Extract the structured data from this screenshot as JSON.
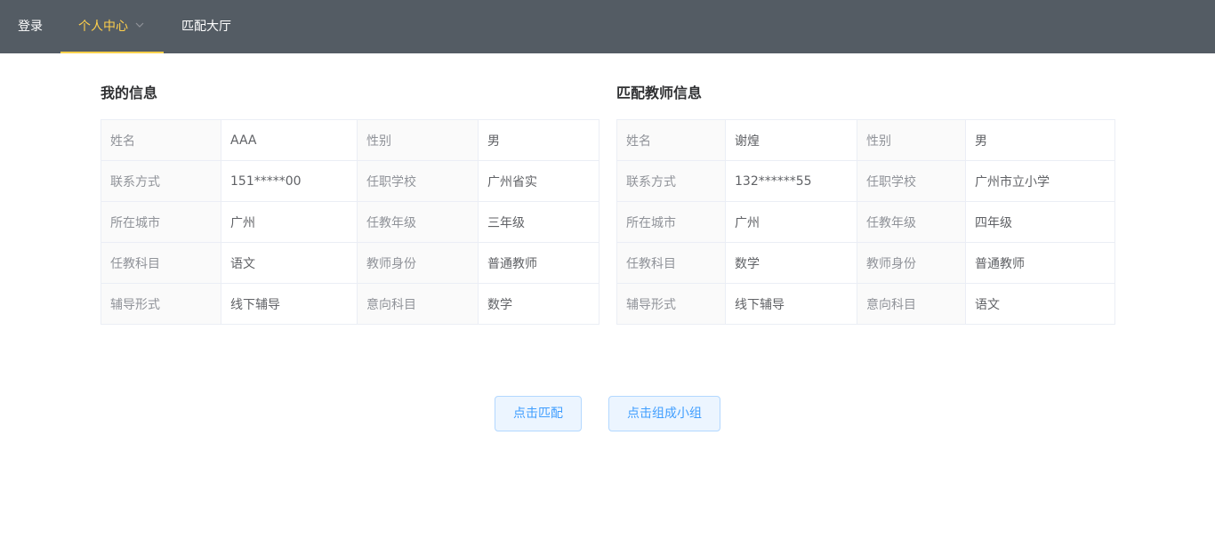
{
  "nav": {
    "login": "登录",
    "personal_center": "个人中心",
    "match_hall": "匹配大厅"
  },
  "my_info": {
    "title": "我的信息",
    "rows": [
      [
        {
          "label": "姓名",
          "value": "AAA"
        },
        {
          "label": "性别",
          "value": "男"
        }
      ],
      [
        {
          "label": "联系方式",
          "value": "151*****00"
        },
        {
          "label": "任职学校",
          "value": "广州省实"
        }
      ],
      [
        {
          "label": "所在城市",
          "value": "广州"
        },
        {
          "label": "任教年级",
          "value": "三年级"
        }
      ],
      [
        {
          "label": "任教科目",
          "value": "语文"
        },
        {
          "label": "教师身份",
          "value": "普通教师"
        }
      ],
      [
        {
          "label": "辅导形式",
          "value": "线下辅导"
        },
        {
          "label": "意向科目",
          "value": "数学"
        }
      ]
    ]
  },
  "teacher_info": {
    "title": "匹配教师信息",
    "rows": [
      [
        {
          "label": "姓名",
          "value": "谢煌"
        },
        {
          "label": "性别",
          "value": "男"
        }
      ],
      [
        {
          "label": "联系方式",
          "value": "132******55"
        },
        {
          "label": "任职学校",
          "value": "广州市立小学"
        }
      ],
      [
        {
          "label": "所在城市",
          "value": "广州"
        },
        {
          "label": "任教年级",
          "value": "四年级"
        }
      ],
      [
        {
          "label": "任教科目",
          "value": "数学"
        },
        {
          "label": "教师身份",
          "value": "普通教师"
        }
      ],
      [
        {
          "label": "辅导形式",
          "value": "线下辅导"
        },
        {
          "label": "意向科目",
          "value": "语文"
        }
      ]
    ]
  },
  "actions": {
    "match": "点击匹配",
    "form_group": "点击组成小组"
  },
  "colors": {
    "nav_bg": "#545c64",
    "nav_active": "#ffd04b",
    "button_text": "#409eff"
  }
}
